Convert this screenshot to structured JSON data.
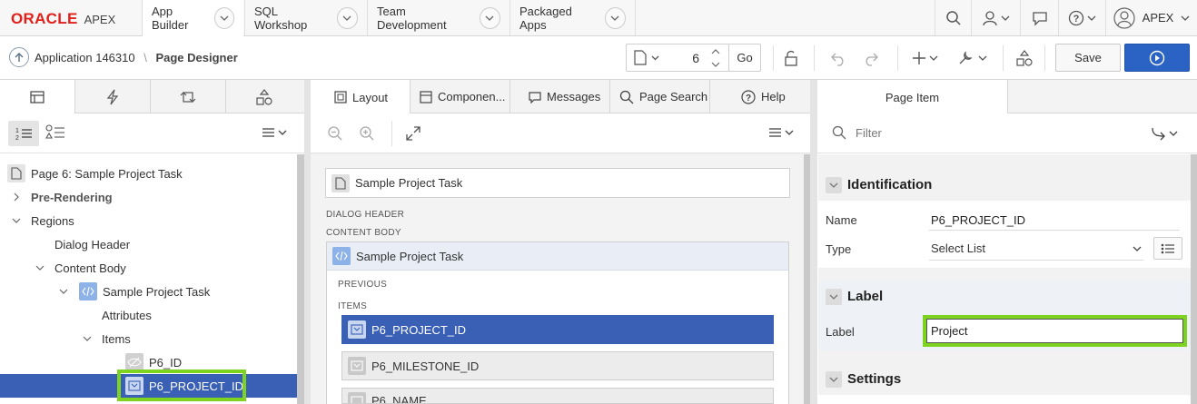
{
  "brand": {
    "oracle": "ORACLE",
    "apex": "APEX"
  },
  "nav": {
    "tabs": [
      "App Builder",
      "SQL Workshop",
      "Team Development",
      "Packaged Apps"
    ],
    "user": "APEX"
  },
  "toolbar": {
    "breadcrumb_app": "Application 146310",
    "breadcrumb_sep": "\\",
    "breadcrumb_page": "Page Designer",
    "page_number": "6",
    "go_label": "Go",
    "save_label": "Save"
  },
  "middle": {
    "tabs": [
      "Layout",
      "Componen...",
      "Messages",
      "Page Search",
      "Help"
    ],
    "page_title": "Sample Project Task",
    "dialog_header": "DIALOG HEADER",
    "content_body": "CONTENT BODY",
    "region_title": "Sample Project Task",
    "previous": "PREVIOUS",
    "items_label": "ITEMS",
    "items": [
      "P6_PROJECT_ID",
      "P6_MILESTONE_ID",
      "P6_NAME"
    ]
  },
  "tree": {
    "rows": [
      "Page 6: Sample Project Task",
      "Pre-Rendering",
      "Regions",
      "Dialog Header",
      "Content Body",
      "Sample Project Task",
      "Attributes",
      "Items",
      "P6_ID",
      "P6_PROJECT_ID"
    ]
  },
  "props": {
    "tab": "Page Item",
    "filter_placeholder": "Filter",
    "identification": "Identification",
    "name_label": "Name",
    "name_value": "P6_PROJECT_ID",
    "type_label": "Type",
    "type_value": "Select List",
    "label_group": "Label",
    "label_label": "Label",
    "label_value": "Project",
    "settings": "Settings"
  },
  "colors": {
    "accent": "#3a60b6",
    "brand_red": "#e0201b",
    "highlight": "#7ed321",
    "run_button": "#2b63c4"
  }
}
